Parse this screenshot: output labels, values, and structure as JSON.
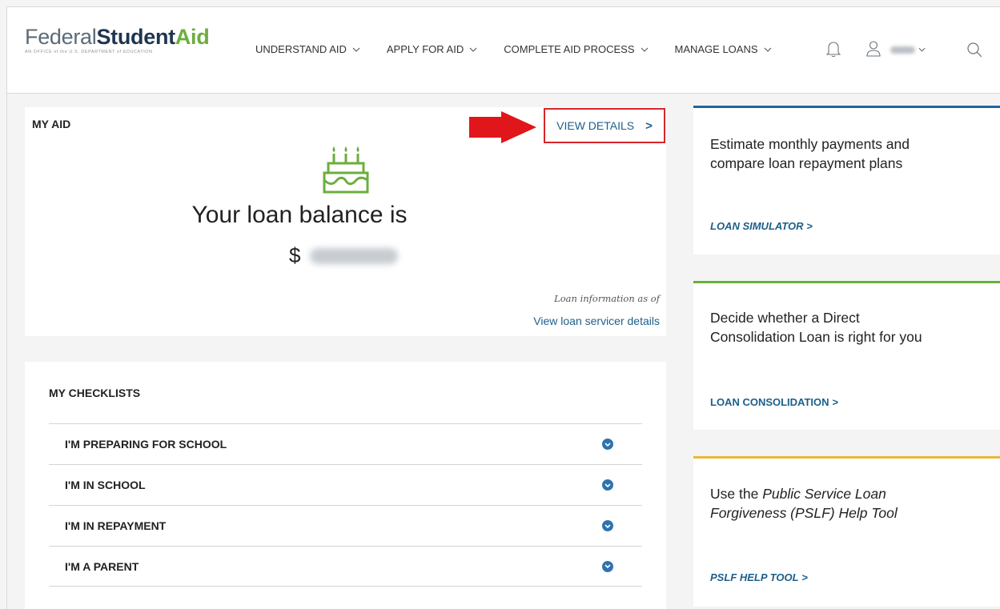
{
  "logo": {
    "federal": "Federal",
    "student": "Student",
    "aid": "Aid",
    "subtitle": "AN OFFICE of the U.S. DEPARTMENT of EDUCATION"
  },
  "nav": {
    "items": [
      {
        "label": "UNDERSTAND AID"
      },
      {
        "label": "APPLY FOR AID"
      },
      {
        "label": "COMPLETE AID PROCESS"
      },
      {
        "label": "MANAGE LOANS"
      }
    ],
    "icons": [
      "bell-icon",
      "user-icon",
      "chevron-down-icon",
      "search-icon"
    ]
  },
  "my_aid": {
    "title": "MY AID",
    "view_details": "VIEW DETAILS",
    "view_details_arrow": ">",
    "balance_text": "Your loan balance is",
    "currency": "$",
    "loan_info": "Loan information as of",
    "servicer_link": "View loan servicer details"
  },
  "checklists": {
    "title": "MY CHECKLISTS",
    "items": [
      {
        "label": "I'M PREPARING FOR SCHOOL"
      },
      {
        "label": "I'M IN SCHOOL"
      },
      {
        "label": "I'M IN REPAYMENT"
      },
      {
        "label": "I'M A PARENT"
      }
    ]
  },
  "side_cards": {
    "simulator": {
      "text": "Estimate monthly payments and compare loan repayment plans",
      "link": "LOAN SIMULATOR"
    },
    "consolidation": {
      "text": "Decide whether a Direct Consolidation Loan is right for you",
      "link": "LOAN CONSOLIDATION"
    },
    "pslf": {
      "text_prefix": "Use the ",
      "text_em": "Public Service Loan Forgiveness (PSLF) Help Tool",
      "link": "PSLF HELP TOOL"
    },
    "link_arrow": ">"
  },
  "colors": {
    "brand_navy": "#1f3550",
    "brand_green": "#6cae3e",
    "link_blue": "#1d5f8a",
    "simulator_bar": "#20659c",
    "consolidation_bar": "#6cae3e",
    "pslf_bar": "#e8b83a",
    "annotation_red": "#d7252b"
  }
}
